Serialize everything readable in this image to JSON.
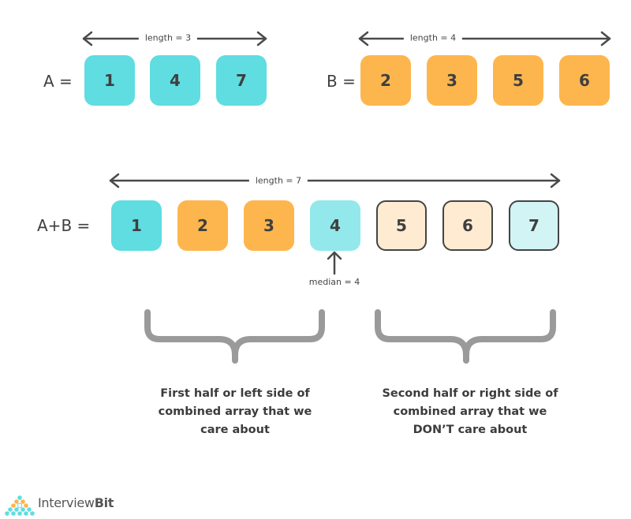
{
  "colors": {
    "teal": "#5fdde1",
    "teal_light": "#93e8eb",
    "teal_pale": "#d2f4f5",
    "orange": "#fdb64d",
    "orange_pale": "#feebd2",
    "outline": "#444444",
    "brace": "#999999",
    "text": "#3f3f3f"
  },
  "array_a": {
    "label": "A =",
    "length_label": "length = 3",
    "items": [
      {
        "value": "1",
        "style": "teal"
      },
      {
        "value": "4",
        "style": "teal"
      },
      {
        "value": "7",
        "style": "teal"
      }
    ]
  },
  "array_b": {
    "label": "B =",
    "length_label": "length = 4",
    "items": [
      {
        "value": "2",
        "style": "orange"
      },
      {
        "value": "3",
        "style": "orange"
      },
      {
        "value": "5",
        "style": "orange"
      },
      {
        "value": "6",
        "style": "orange"
      }
    ]
  },
  "combined": {
    "label": "A+B =",
    "length_label": "length = 7",
    "items": [
      {
        "value": "1",
        "style": "teal"
      },
      {
        "value": "2",
        "style": "orange"
      },
      {
        "value": "3",
        "style": "orange"
      },
      {
        "value": "4",
        "style": "teal_light"
      },
      {
        "value": "5",
        "style": "orange_pale_outlined"
      },
      {
        "value": "6",
        "style": "orange_pale_outlined"
      },
      {
        "value": "7",
        "style": "teal_pale_outlined"
      }
    ],
    "median_label": "median = 4",
    "median_index": 3
  },
  "captions": {
    "left": [
      "First half or left side of",
      "combined array that we",
      "care about"
    ],
    "right": [
      "Second half or right side of",
      "combined array that we",
      "DON’T care about"
    ]
  },
  "logo": {
    "text_a": "Interview",
    "text_b": "Bit"
  }
}
